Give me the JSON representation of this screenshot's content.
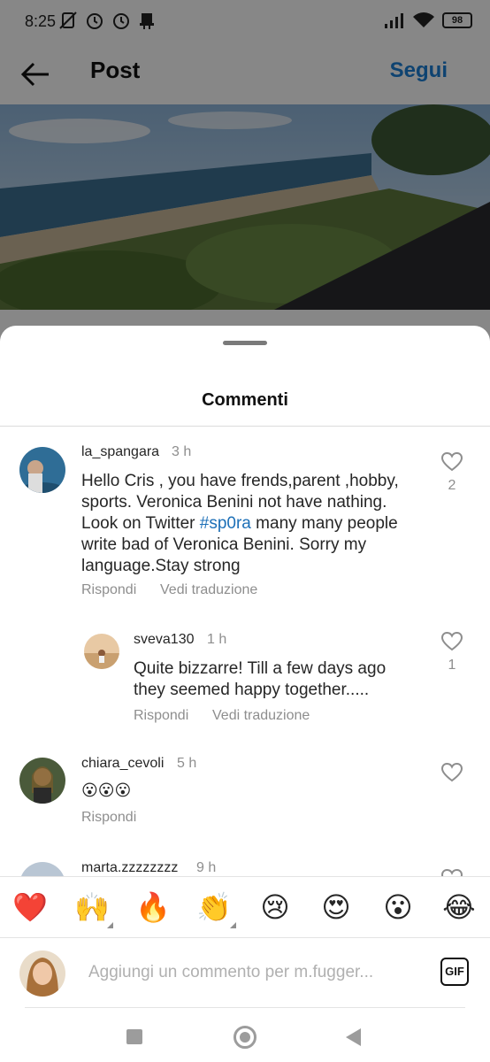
{
  "status_bar": {
    "time": "8:25",
    "battery": "98"
  },
  "header": {
    "title": "Post",
    "follow_label": "Segui"
  },
  "sheet": {
    "title": "Commenti"
  },
  "comments": [
    {
      "username": "la_spangara",
      "time": "3 h",
      "text_before": "Hello Cris , you have frends,parent ,hobby, sports. Veronica Benini not have nathing. Look on Twitter ",
      "hashtag": "#sp0ra",
      "text_after": " many many people write bad  of Veronica Benini. Sorry my language.Stay strong",
      "reply": "Rispondi",
      "translate": "Vedi traduzione",
      "likes": "2"
    },
    {
      "username": "sveva130",
      "time": "1 h",
      "text": "Quite bizzarre! Till a few days ago they seemed happy together.....",
      "reply": "Rispondi",
      "translate": "Vedi traduzione",
      "likes": "1"
    },
    {
      "username": "chiara_cevoli",
      "time": "5 h",
      "text": "😮😮😮",
      "reply": "Rispondi"
    },
    {
      "username": "marta.zzzzzzzz",
      "time": "9 h"
    }
  ],
  "emoji_bar": [
    "❤️",
    "🙌",
    "🔥",
    "👏",
    "😢",
    "😍",
    "😮",
    "😂"
  ],
  "comment_input": {
    "placeholder": "Aggiungi un commento per m.fugger..."
  },
  "gif_label": "GIF",
  "colors": {
    "accent": "#1c7fd6",
    "hashtag": "#1c6fb7",
    "muted": "#8e8e8e"
  }
}
